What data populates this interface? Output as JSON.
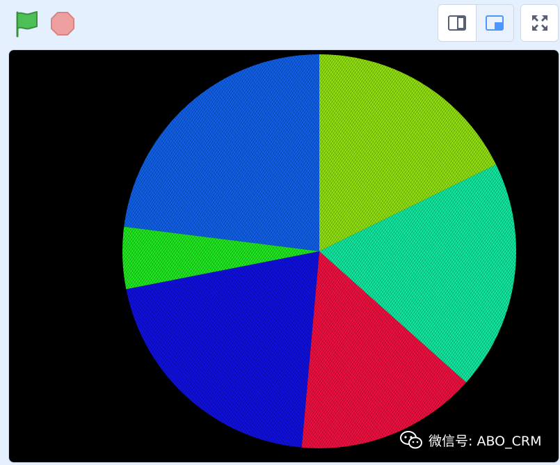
{
  "toolbar": {
    "green_flag": {
      "icon": "green-flag-icon",
      "color": "#4cbf56"
    },
    "stop": {
      "icon": "stop-sign-icon",
      "color": "#ec9c9c"
    },
    "layout_buttons": [
      {
        "icon": "small-stage-icon",
        "active": false
      },
      {
        "icon": "normal-stage-icon",
        "active": true
      }
    ],
    "fullscreen": {
      "icon": "fullscreen-icon"
    }
  },
  "stage": {
    "background": "#000000",
    "sectors": [
      {
        "name": "blue-upper",
        "color": "#1060e8"
      },
      {
        "name": "yellow-green",
        "color": "#90e010"
      },
      {
        "name": "aqua-green",
        "color": "#10e8a0"
      },
      {
        "name": "red",
        "color": "#f01040"
      },
      {
        "name": "blue-lower",
        "color": "#1010e0"
      },
      {
        "name": "green",
        "color": "#20e820"
      }
    ]
  },
  "watermark": {
    "icon": "wechat-icon",
    "text": "微信号: ABO_CRM"
  }
}
